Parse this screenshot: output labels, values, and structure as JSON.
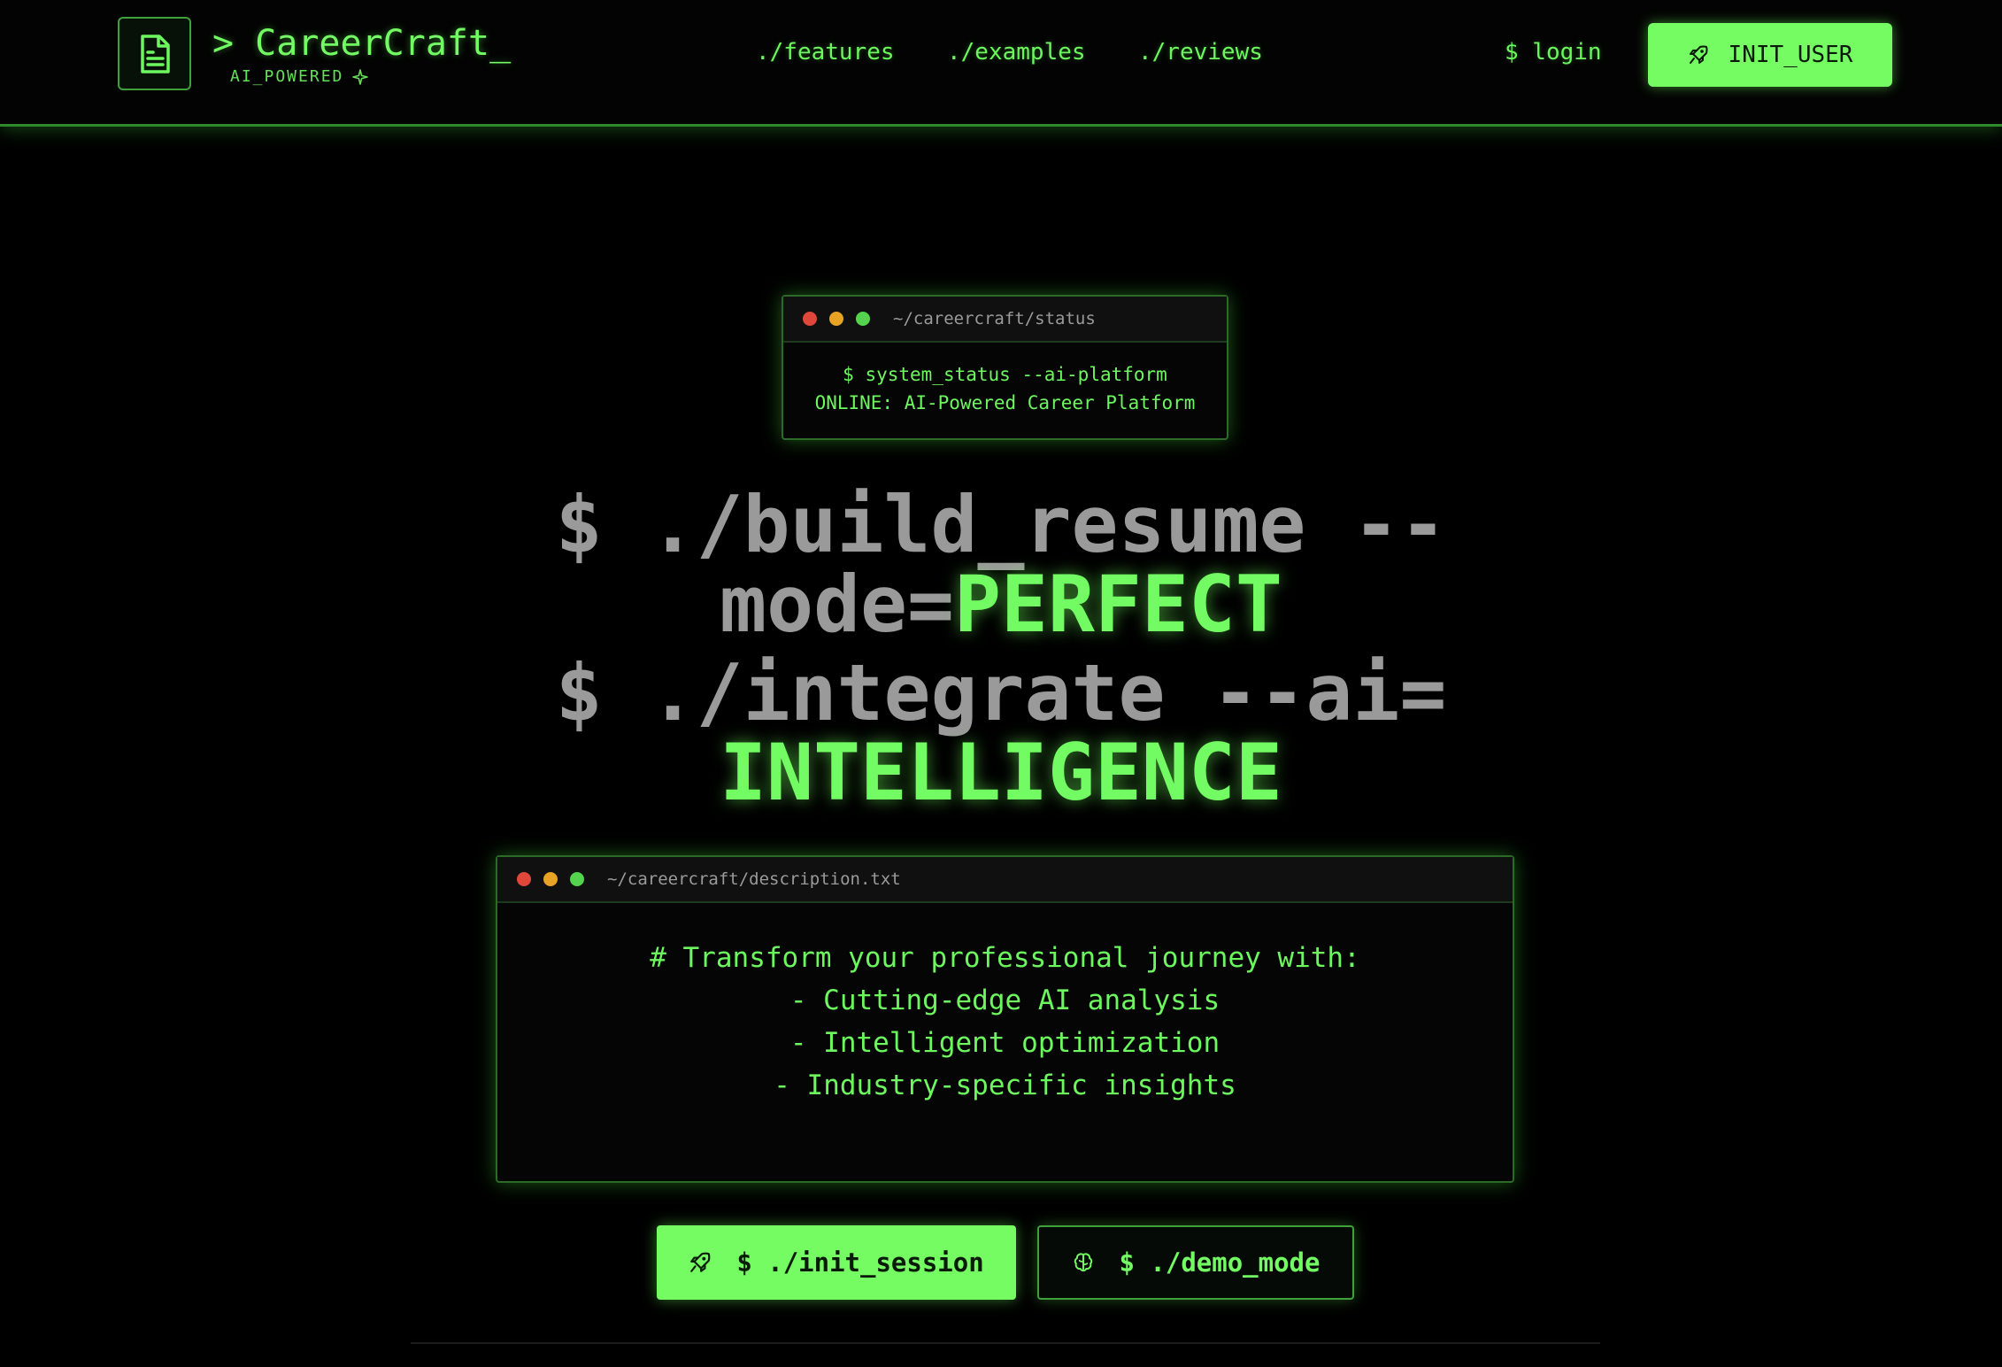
{
  "header": {
    "brand_name": "> CareerCraft_",
    "brand_tag": "AI_POWERED",
    "logo_icon": "document-icon",
    "sparkle_icon": "sparkle-icon",
    "nav": [
      "./features",
      "./examples",
      "./reviews"
    ],
    "login_label": "$ login",
    "cta_label": "INIT_USER",
    "cta_icon": "rocket-icon"
  },
  "status_terminal": {
    "path": "~/careercraft/status",
    "line1": "$ system_status --ai-platform",
    "line2": "ONLINE: AI-Powered Career Platform"
  },
  "headline": {
    "line1_plain": "$ ./build_resume --",
    "line2_plain": "mode=",
    "line2_highlight": "PERFECT",
    "line3_plain": "$ ./integrate --ai=",
    "line4_highlight": "INTELLIGENCE"
  },
  "description_terminal": {
    "path": "~/careercraft/description.txt",
    "lines": [
      "# Transform your professional journey with:",
      "- Cutting-edge AI analysis",
      "- Intelligent optimization",
      "- Industry-specific insights"
    ]
  },
  "actions": {
    "primary_label": "$ ./init_session",
    "primary_icon": "rocket-icon",
    "secondary_label": "$ ./demo_mode",
    "secondary_icon": "brain-icon"
  },
  "colors": {
    "accent": "#74fc62",
    "background": "#000000",
    "muted_text": "#9a9a9a"
  }
}
